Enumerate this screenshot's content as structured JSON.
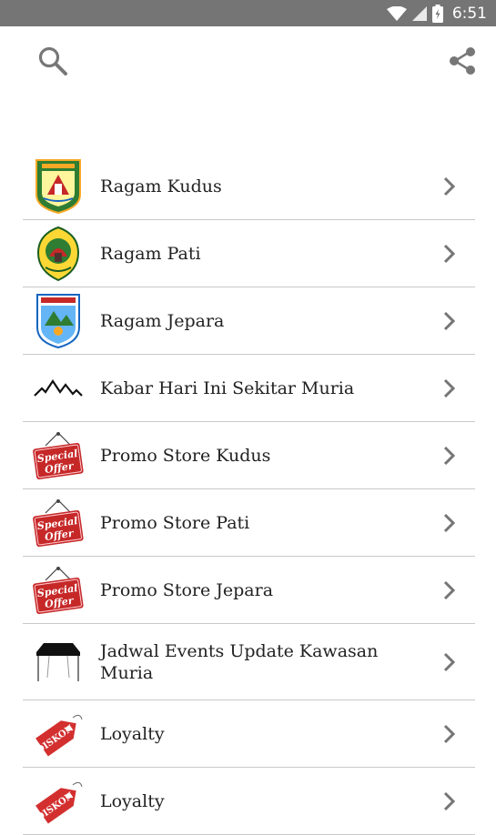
{
  "status_bar": {
    "time": "6:51",
    "icons": [
      "wifi-icon",
      "signal-icon",
      "battery-icon"
    ]
  },
  "toolbar": {
    "left_icon": "search-icon",
    "right_icon": "share-icon"
  },
  "menu": {
    "items": [
      {
        "label": "Ragam Kudus",
        "icon": "kudus-emblem-icon"
      },
      {
        "label": "Ragam Pati",
        "icon": "pati-emblem-icon"
      },
      {
        "label": "Ragam Jepara",
        "icon": "jepara-emblem-icon"
      },
      {
        "label": "Kabar Hari Ini Sekitar Muria",
        "icon": "mountains-icon"
      },
      {
        "label": "Promo Store Kudus",
        "icon": "special-offer-sign-icon",
        "badge_line1": "Special",
        "badge_line2": "Offer"
      },
      {
        "label": "Promo Store Pati",
        "icon": "special-offer-sign-icon",
        "badge_line1": "Special",
        "badge_line2": "Offer"
      },
      {
        "label": "Promo Store Jepara",
        "icon": "special-offer-sign-icon",
        "badge_line1": "Special",
        "badge_line2": "Offer"
      },
      {
        "label": "Jadwal Events Update Kawasan Muria",
        "icon": "event-tent-icon"
      },
      {
        "label": "Loyalty",
        "icon": "diskon-tag-icon",
        "tag_text": "DISKON"
      },
      {
        "label": "Loyalty",
        "icon": "diskon-tag-icon",
        "tag_text": "DISKON"
      }
    ]
  },
  "colors": {
    "status_bar": "#757575",
    "divider": "#c9c9c9",
    "icon_gray": "#777777",
    "promo_red": "#c62828"
  }
}
